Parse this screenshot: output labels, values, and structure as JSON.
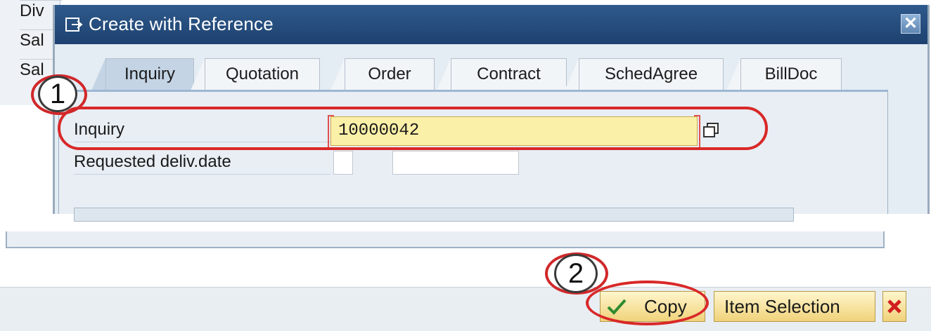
{
  "background": {
    "rows": [
      "Div",
      "Sal",
      "Sal"
    ]
  },
  "dialog": {
    "title": "Create with Reference",
    "close_icon": "close-icon",
    "title_icon": "create-reference-icon"
  },
  "tabs": [
    {
      "label": "Inquiry",
      "active": true
    },
    {
      "label": "Quotation",
      "active": false
    },
    {
      "label": "Order",
      "active": false
    },
    {
      "label": "Contract",
      "active": false
    },
    {
      "label": "SchedAgree",
      "active": false
    },
    {
      "label": "BillDoc",
      "active": false
    }
  ],
  "form": {
    "inquiry_label": "Inquiry",
    "inquiry_value": "10000042",
    "requested_delivery_label": "Requested deliv.date",
    "requested_delivery_value": ""
  },
  "buttons": {
    "copy": "Copy",
    "item_selection": "Item Selection",
    "cancel_icon": "cancel-icon"
  },
  "callouts": {
    "step1": "1",
    "step2": "2"
  },
  "colors": {
    "title_bar": "#1d416f",
    "input_highlight": "#fbf0a8",
    "annotation_red": "#d92828"
  }
}
